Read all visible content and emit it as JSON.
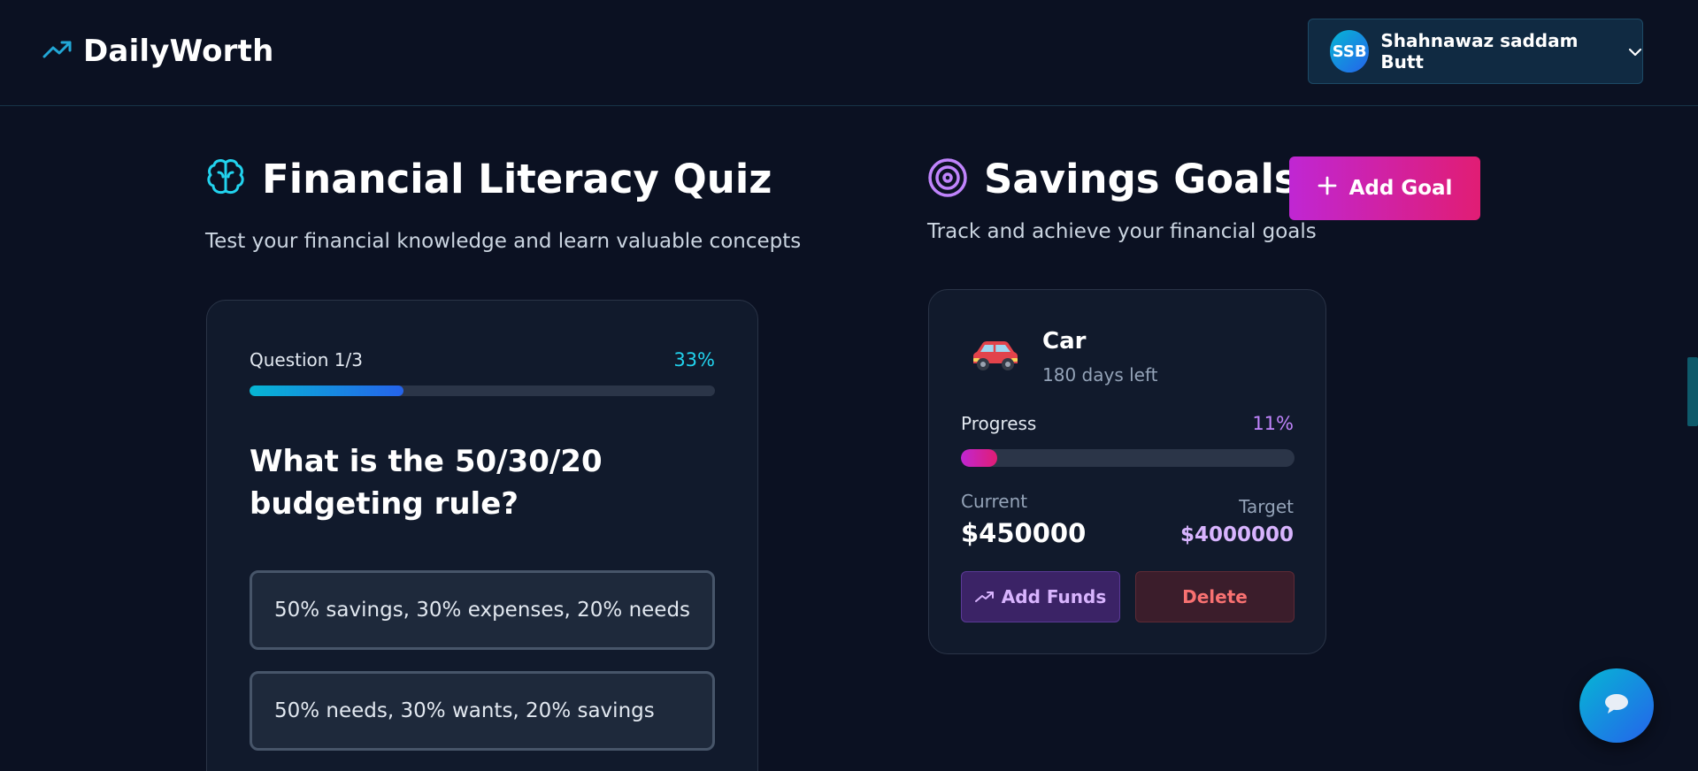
{
  "header": {
    "brand_name": "DailyWorth",
    "brand_icon": "trending-up-icon",
    "user": {
      "initials": "SSB",
      "name": "Shahnawaz saddam Butt"
    }
  },
  "quiz": {
    "title": "Financial Literacy Quiz",
    "icon": "brain-icon",
    "subtitle": "Test your financial knowledge and learn valuable concepts",
    "progress_label": "Question 1/3",
    "progress_percent_text": "33%",
    "progress_value": 0.33,
    "question": "What is the 50/30/20 budgeting rule?",
    "options": [
      "50% savings, 30% expenses, 20% needs",
      "50% needs, 30% wants, 20% savings"
    ]
  },
  "savings": {
    "title": "Savings Goals",
    "icon": "target-icon",
    "subtitle": "Track and achieve your financial goals",
    "add_goal_label": "Add Goal",
    "goals": [
      {
        "name": "Car",
        "emoji": "car",
        "days_left": "180 days left",
        "progress_label": "Progress",
        "progress_percent_text": "11%",
        "progress_value": 0.11,
        "current_label": "Current",
        "current_value": "$450000",
        "target_label": "Target",
        "target_value": "$4000000",
        "add_funds_label": "Add Funds",
        "delete_label": "Delete"
      }
    ]
  },
  "colors": {
    "background": "#0b1122",
    "accent_cyan": "#22d3ee",
    "accent_pink": "#e11d74",
    "accent_purple": "#c084fc"
  }
}
